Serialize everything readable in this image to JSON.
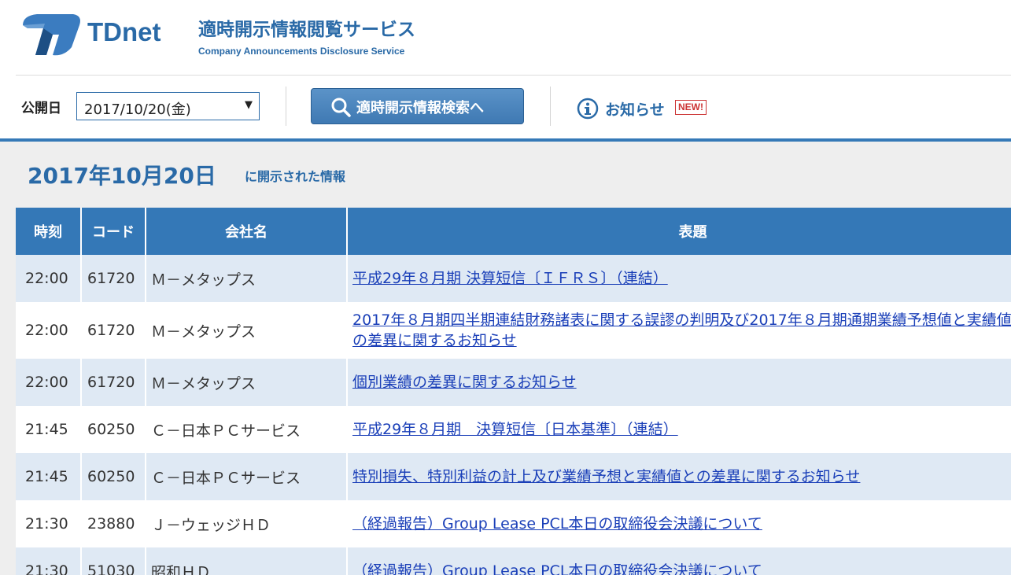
{
  "brand": {
    "logo_text": "TDnet",
    "title": "適時開示情報閲覧サービス",
    "subtitle": "Company Announcements Disclosure Service"
  },
  "toolbar": {
    "date_label": "公開日",
    "date_value": "2017/10/20(金)",
    "search_label": "適時開示情報検索へ",
    "notice_label": "お知らせ",
    "new_badge": "NEW!"
  },
  "content": {
    "date_heading": "2017年10月20日",
    "date_sub": "に開示された情報"
  },
  "table": {
    "headers": [
      "時刻",
      "コード",
      "会社名",
      "表題"
    ],
    "rows": [
      {
        "time": "22:00",
        "code": "61720",
        "company": "Ｍ－メタップス",
        "title": "平成29年８月期 決算短信〔ＩＦＲＳ〕（連結）"
      },
      {
        "time": "22:00",
        "code": "61720",
        "company": "Ｍ－メタップス",
        "title": "2017年８月期四半期連結財務諸表に関する誤謬の判明及び2017年８月期通期業績予想値と実績値との差異に関するお知らせ"
      },
      {
        "time": "22:00",
        "code": "61720",
        "company": "Ｍ－メタップス",
        "title": "個別業績の差異に関するお知らせ"
      },
      {
        "time": "21:45",
        "code": "60250",
        "company": "Ｃ－日本ＰＣサービス",
        "title": "平成29年８月期　決算短信〔日本基準〕（連結）"
      },
      {
        "time": "21:45",
        "code": "60250",
        "company": "Ｃ－日本ＰＣサービス",
        "title": "特別損失、特別利益の計上及び業績予想と実績値との差異に関するお知らせ"
      },
      {
        "time": "21:30",
        "code": "23880",
        "company": "Ｊ－ウェッジＨＤ",
        "title": "（経過報告）Group Lease PCL本日の取締役会決議について"
      },
      {
        "time": "21:30",
        "code": "51030",
        "company": "昭和ＨＤ",
        "title": "（経過報告）Group Lease PCL本日の取締役会決議について"
      }
    ]
  },
  "colors": {
    "brand_blue": "#2a6aa7",
    "header_blue": "#3478b7",
    "row_alt": "#dfe9f4",
    "link": "#1a3fb8",
    "new_badge": "#cc3333"
  },
  "icons": [
    "tdnet-logo",
    "search-icon",
    "info-icon",
    "chevron-down-icon"
  ]
}
